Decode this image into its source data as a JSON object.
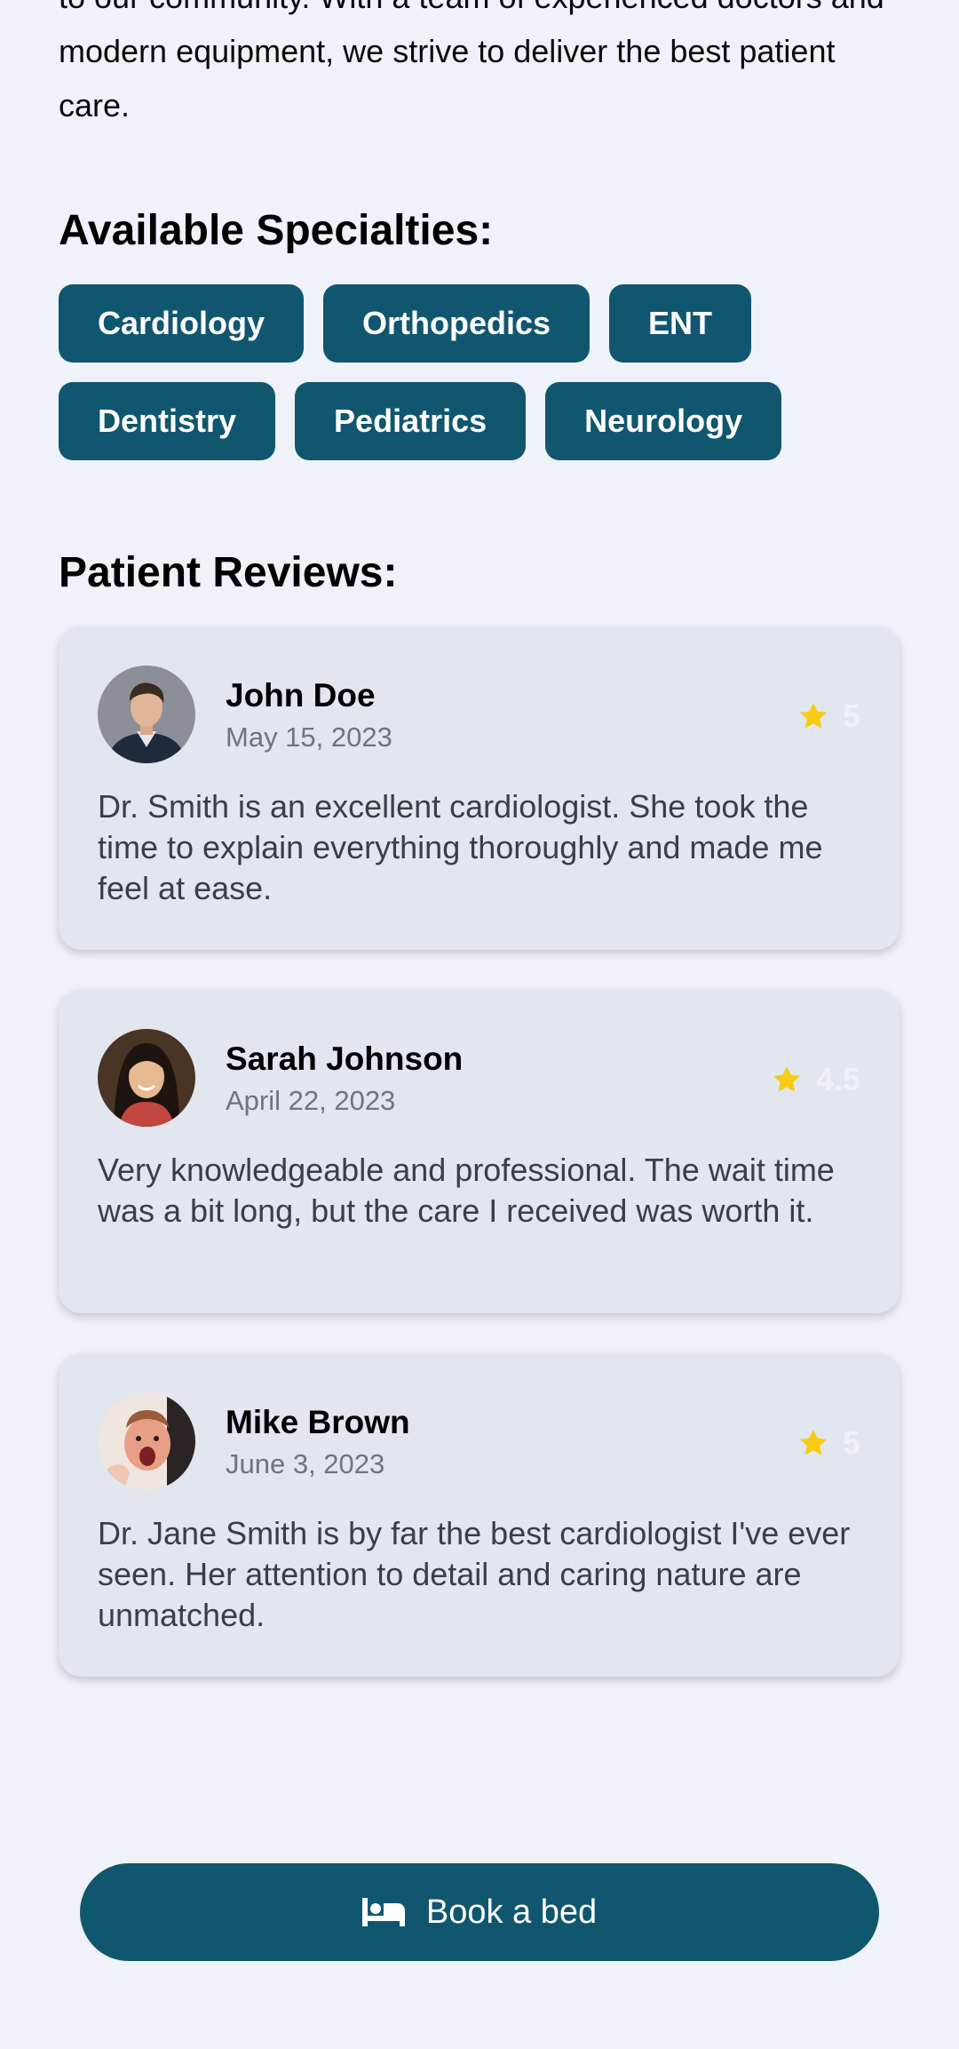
{
  "intro": {
    "text": "to our community. With a team of experienced doctors and modern equipment, we strive to deliver the best patient care."
  },
  "specialties": {
    "title": "Available Specialties:",
    "items": [
      "Cardiology",
      "Orthopedics",
      "ENT",
      "Dentistry",
      "Pediatrics",
      "Neurology"
    ]
  },
  "reviews": {
    "title": "Patient Reviews:",
    "items": [
      {
        "name": "John Doe",
        "date": "May 15, 2023",
        "rating": "5",
        "text": "Dr. Smith is an excellent cardiologist. She took the time to explain everything thoroughly and made me feel at ease."
      },
      {
        "name": "Sarah Johnson",
        "date": "April 22, 2023",
        "rating": "4.5",
        "text": "Very knowledgeable and professional. The wait time was a bit long, but the care I received was worth it."
      },
      {
        "name": "Mike Brown",
        "date": "June 3, 2023",
        "rating": "5",
        "text": "Dr. Jane Smith is by far the best cardiologist I've ever seen. Her attention to detail and caring nature are unmatched."
      }
    ]
  },
  "booking": {
    "label": "Book a bed",
    "icon": "bed-icon"
  },
  "colors": {
    "primary": "#11566f",
    "background": "#eff2f8",
    "card": "#e1e6ef",
    "star": "#f7cc14"
  }
}
